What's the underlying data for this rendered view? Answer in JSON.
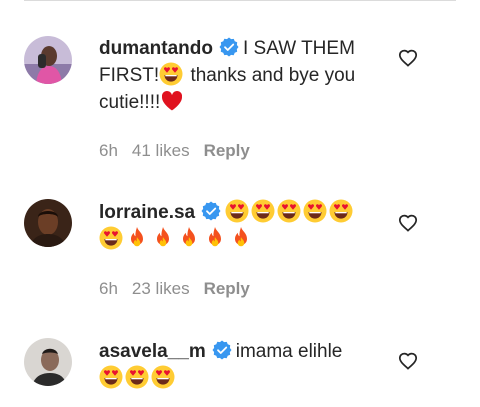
{
  "comments": [
    {
      "username": "dumantando",
      "text_1": "I SAW THEM FIRST!",
      "text_2": "thanks and bye you cutie!!!!",
      "time": "6h",
      "likes": "41 likes",
      "reply_label": "Reply"
    },
    {
      "username": "lorraine.sa",
      "time": "6h",
      "likes": "23 likes",
      "reply_label": "Reply"
    },
    {
      "username": "asavela__m",
      "text_1": "imama elihle"
    }
  ],
  "colors": {
    "verified": "#3897f0",
    "meta": "#8e8e8e",
    "text": "#262626"
  },
  "icons": [
    "verified-badge-icon",
    "heart-outline-icon",
    "heart-eyes-emoji",
    "fire-emoji",
    "red-heart-emoji"
  ]
}
